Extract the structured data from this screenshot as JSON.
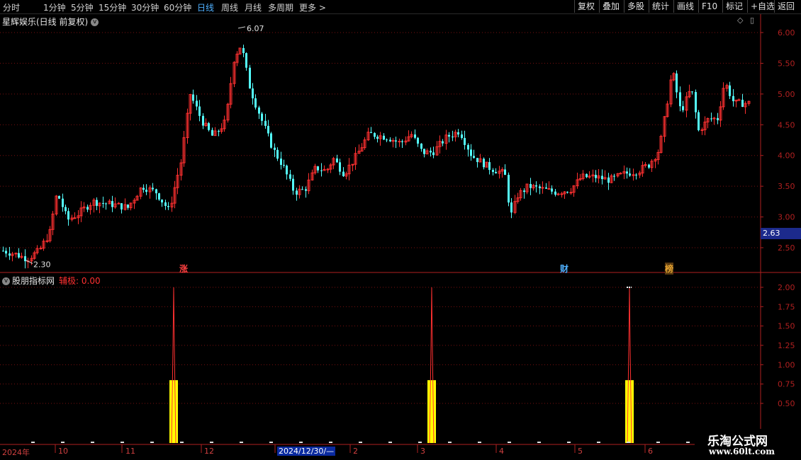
{
  "toolbar": {
    "timeframes": [
      "分时",
      "1分钟",
      "5分钟",
      "15分钟",
      "30分钟",
      "60分钟",
      "日线",
      "周线",
      "月线",
      "多周期",
      "更多 >"
    ],
    "active_timeframe": "日线",
    "right_buttons": [
      "复权",
      "叠加",
      "多股",
      "统计",
      "画线",
      "F10",
      "标记",
      "+自选",
      "返回"
    ]
  },
  "chart_header": {
    "stock_name": "星辉娱乐(日线 前复权)",
    "chevron_icon": "chevron-down-icon"
  },
  "price_axis": {
    "ticks": [
      "6.00",
      "5.50",
      "5.00",
      "4.50",
      "4.00",
      "3.50",
      "3.00",
      "2.50"
    ],
    "current_price": "2.63"
  },
  "annotations": {
    "high_label": "6.07",
    "low_label": "2.30"
  },
  "event_tags": [
    {
      "text": "涨",
      "color": "#ff4040"
    },
    {
      "text": "财",
      "color": "#4fb0ff"
    },
    {
      "text": "榜",
      "color": "#e0a030"
    }
  ],
  "indicator": {
    "name": "股朋指标网",
    "value_label": "辅极: 0.00",
    "axis_ticks": [
      "2.00",
      "1.75",
      "1.50",
      "1.25",
      "1.00",
      "0.75",
      "0.50"
    ],
    "signal_value": 2.0,
    "signal_bar_value": 0.8
  },
  "date_axis": {
    "labels": [
      "2024年",
      "10",
      "11",
      "12",
      "2024/12/30/—",
      "2",
      "3",
      "4",
      "5",
      "6"
    ],
    "highlighted": "2024/12/30/—"
  },
  "watermark": {
    "line1": "乐淘公式网",
    "line2": "www.60lt.com"
  },
  "colors": {
    "up": "#ff3030",
    "down": "#54ffff",
    "grid": "#7a1010",
    "axis": "#b02020",
    "signal": "#ffff00"
  }
}
